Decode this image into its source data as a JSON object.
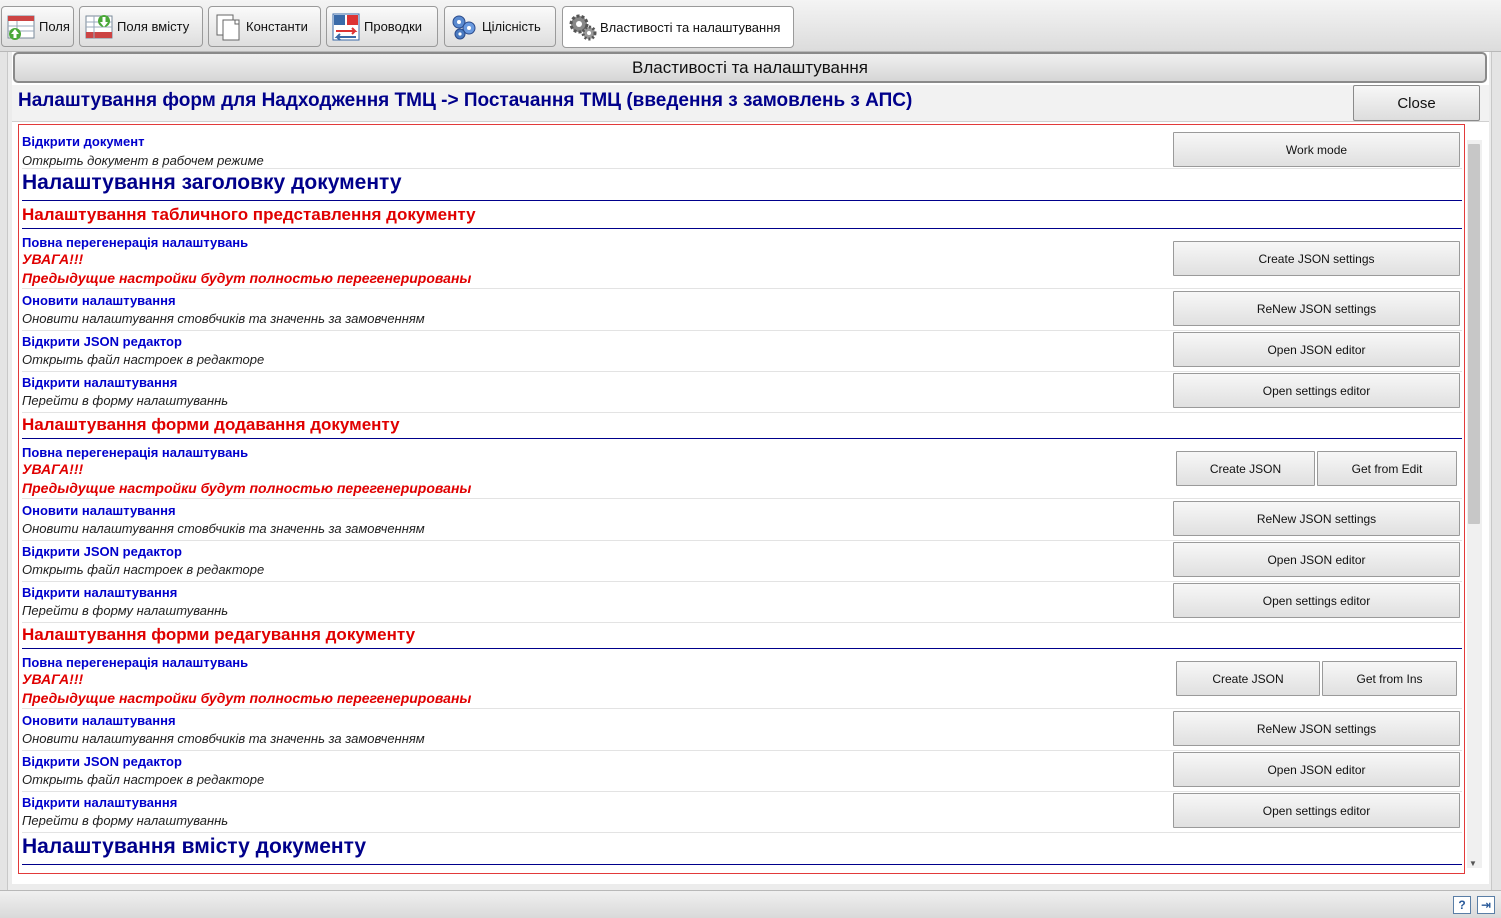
{
  "tabs": [
    {
      "label": "Поля",
      "icon": "table-fields-icon"
    },
    {
      "label": "Поля вмісту",
      "icon": "table-content-icon"
    },
    {
      "label": "Константи",
      "icon": "documents-icon"
    },
    {
      "label": "Проводки",
      "icon": "debit-credit-icon"
    },
    {
      "label": "Цілісність",
      "icon": "integrity-icon"
    },
    {
      "label": "Властивості та налаштування",
      "icon": "gears-icon"
    }
  ],
  "panel": {
    "title": "Властивості та налаштування",
    "form_title": "Налаштування форм для Надходження ТМЦ -> Постачання ТМЦ (введення з замовлень з АПС)",
    "close_label": "Close"
  },
  "open_doc": {
    "title": "Відкрити документ",
    "desc": "Открыть документ в рабочем режиме",
    "button": "Work mode"
  },
  "sections": {
    "header": "Налаштування заголовку документу",
    "table": "Налаштування табличного представлення документу",
    "add": "Налаштування форми додавання документу",
    "edit": "Налаштування форми редагування документу",
    "content": "Налаштування вмісту документу"
  },
  "table_rows": {
    "regen": {
      "title": "Повна перегенерація налаштувань",
      "warn": "УВАГА!!!",
      "desc": "Предыдущие настройки будут полностью перегенерированы",
      "button": "Create JSON settings"
    },
    "renew": {
      "title": "Оновити налаштування",
      "desc": "Оновити налаштування стовбчиків та значеннь за замовченням",
      "button": "ReNew JSON settings"
    },
    "json": {
      "title": "Відкрити JSON редактор",
      "desc": "Открыть файл настроек в редакторе",
      "button": "Open JSON editor"
    },
    "settings": {
      "title": "Відкрити налаштування",
      "desc": "Перейти в форму налаштуваннь",
      "button": "Open settings editor"
    }
  },
  "add_rows": {
    "regen": {
      "title": "Повна перегенерація налаштувань",
      "warn": "УВАГА!!!",
      "desc": "Предыдущие настройки будут полностью перегенерированы",
      "button1": "Create JSON",
      "button2": "Get from Edit"
    },
    "renew": {
      "title": "Оновити налаштування",
      "desc": "Оновити налаштування стовбчиків та значеннь за замовченням",
      "button": "ReNew JSON settings"
    },
    "json": {
      "title": "Відкрити JSON редактор",
      "desc": "Открыть файл настроек в редакторе",
      "button": "Open JSON editor"
    },
    "settings": {
      "title": "Відкрити налаштування",
      "desc": "Перейти в форму налаштуваннь",
      "button": "Open settings editor"
    }
  },
  "edit_rows": {
    "regen": {
      "title": "Повна перегенерація налаштувань",
      "warn": "УВАГА!!!",
      "desc": "Предыдущие настройки будут полностью перегенерированы",
      "button1": "Create JSON",
      "button2": "Get from Ins"
    },
    "renew": {
      "title": "Оновити налаштування",
      "desc": "Оновити налаштування стовбчиків та значеннь за замовченням",
      "button": "ReNew JSON settings"
    },
    "json": {
      "title": "Відкрити JSON редактор",
      "desc": "Открыть файл настроек в редакторе",
      "button": "Open JSON editor"
    },
    "settings": {
      "title": "Відкрити налаштування",
      "desc": "Перейти в форму налаштуваннь",
      "button": "Open settings editor"
    }
  },
  "status_buttons": {
    "help": "?",
    "exit": "⇥"
  },
  "colors": {
    "section_blue": "#00008b",
    "section_red": "#e00000",
    "link_blue": "#0000cd",
    "border_red": "#e23a3a"
  }
}
